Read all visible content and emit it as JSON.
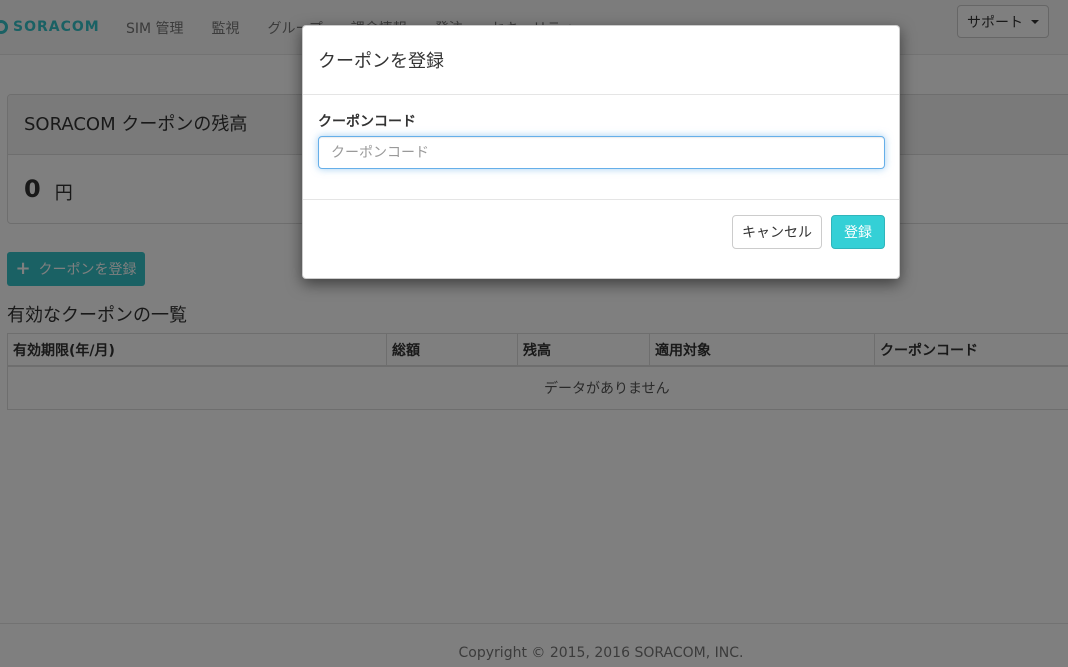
{
  "navbar": {
    "brand": "SORACOM",
    "items": [
      "SIM 管理",
      "監視",
      "グループ",
      "課金情報",
      "発注",
      "セキュリティ"
    ],
    "support_label": "サポート"
  },
  "balance_panel": {
    "title": "SORACOM クーポンの残高",
    "amount": "0",
    "unit": "円"
  },
  "add_coupon_button": "クーポンを登録",
  "coupon_list": {
    "title": "有効なクーポンの一覧",
    "columns": [
      "有効期限(年/月)",
      "総額",
      "残高",
      "適用対象",
      "クーポンコード"
    ],
    "empty_message": "データがありません"
  },
  "footer": {
    "copyright": "Copyright © 2015, 2016 SORACOM, INC."
  },
  "modal": {
    "title": "クーポンを登録",
    "field_label": "クーポンコード",
    "field_placeholder": "クーポンコード",
    "field_value": "",
    "cancel_label": "キャンセル",
    "submit_label": "登録"
  },
  "colors": {
    "accent": "#34c2c8",
    "submit_button": "#34d0d6",
    "input_focus_border": "#66afe9"
  }
}
